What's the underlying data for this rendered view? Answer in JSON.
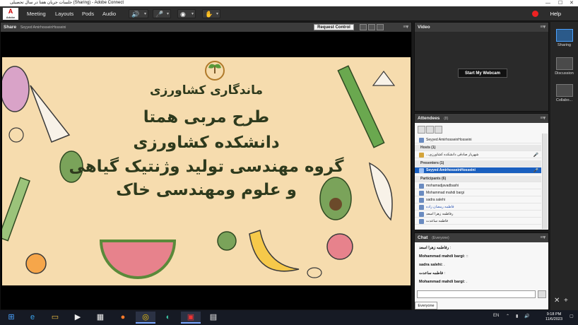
{
  "window": {
    "title": "جلسات جریان هفتا در سال تحصیلی (Sharing) - Adobe Connect",
    "minimize": "—",
    "maximize": "☐",
    "close": "✕"
  },
  "menubar": {
    "adobe_logo": "A",
    "adobe_sub": "Adobe",
    "items": [
      "Meeting",
      "Layouts",
      "Pods",
      "Audio"
    ],
    "help": "Help",
    "speaker_icon": "speaker-icon",
    "mic_icon": "microphone-icon",
    "camera_icon": "webcam-icon",
    "status_icon": "raise-hand-icon"
  },
  "share_pod": {
    "title": "Share",
    "presenter": "Seyyed AmirhosseinHosseini",
    "request_control": "Request Control",
    "slide": {
      "logo_text": "ماندگاری کشاورزی",
      "lines": [
        "طرح مربی همتا",
        "دانشکده کشاورزی",
        "گروه مهندسی تولید وژنتیک گیاهی",
        "و علوم ومهندسی خاک"
      ]
    }
  },
  "video_pod": {
    "title": "Video",
    "start_webcam": "Start My Webcam"
  },
  "attendees_pod": {
    "title": "Attendees",
    "count": "(8)",
    "current_user": "Seyyed AmirhosseinHosseini",
    "hosts_section": "Hosts (1)",
    "host": "...شهریار صادقی دانشکده کشاورزی",
    "presenters_section": "Presenters (1)",
    "presenter": "Seyyed AmirhosseinHosseini",
    "participants_section": "Participants (6)",
    "participants": [
      "mohamadjavadbashi",
      "Mohammad mahdi bargi",
      "sadra salehi",
      "فاطمه رمضان زاده",
      "رفاطمه زهرا اسعد",
      "فاطمه ساعدت"
    ]
  },
  "chat_pod": {
    "title": "Chat",
    "scope": "(Everyone)",
    "messages": [
      {
        "sender": "رفاطمه زهرا اسعد",
        "text": ":"
      },
      {
        "sender": "Mohammad mahdi bargi:",
        "text": "::"
      },
      {
        "sender": "sadra salehi:",
        "text": "."
      },
      {
        "sender": "فاطمه ساعدت",
        "text": ":"
      },
      {
        "sender": "Mohammad mahdi bargi:",
        "text": "."
      }
    ],
    "tab": "Everyone"
  },
  "layouts": [
    {
      "label": "Sharing",
      "active": true
    },
    {
      "label": "Discussion",
      "active": false
    },
    {
      "label": "Collabo...",
      "active": false
    }
  ],
  "taskbar": {
    "lang": "EN",
    "time": "9:18 PM",
    "date": "11/6/2023"
  },
  "colors": {
    "selected_row": "#1a5fbf",
    "slide_bg": "#f6dcae",
    "slide_text": "#2e3a1d",
    "record": "#e22222"
  }
}
